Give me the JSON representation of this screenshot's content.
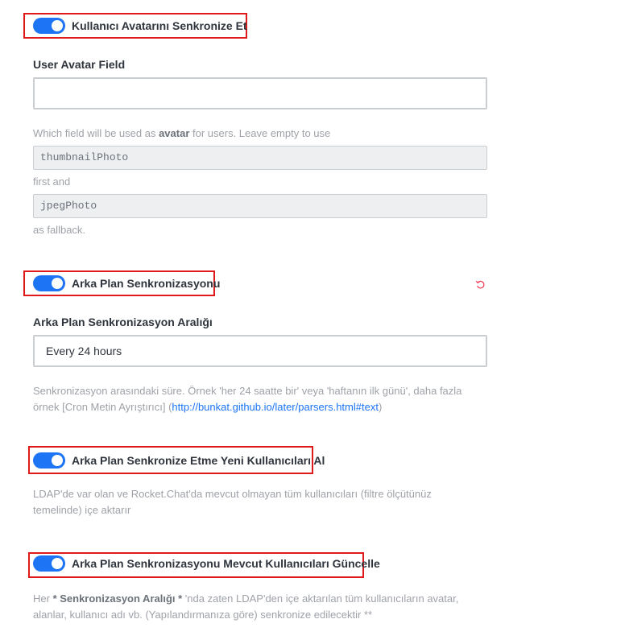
{
  "settings": {
    "sync_avatar": {
      "label": "Kullanıcı Avatarını Senkronize Et",
      "enabled": true
    },
    "avatar_field": {
      "label": "User Avatar Field",
      "value": "",
      "hint_prefix": "Which field will be used as ",
      "hint_bold": "avatar",
      "hint_suffix": " for users. Leave empty to use",
      "code_primary": "thumbnailPhoto",
      "middle_text": "first and",
      "code_fallback": "jpegPhoto",
      "end_text": "as fallback."
    },
    "background_sync": {
      "label": "Arka Plan Senkronizasyonu",
      "enabled": true,
      "reset_icon": "reset-icon"
    },
    "background_sync_interval": {
      "label": "Arka Plan Senkronizasyon Aralığı",
      "value": "Every 24 hours",
      "hint_line1": "Senkronizasyon arasındaki süre. Örnek 'her 24 saatte bir' veya 'haftanın ilk günü', daha fazla",
      "hint_line2_prefix": "örnek [Cron Metin Ayrıştırıcı] (",
      "hint_link": "http://bunkat.github.io/later/parsers.html#text",
      "hint_line2_suffix": ")"
    },
    "background_sync_import_new": {
      "label": "Arka Plan Senkronize Etme Yeni Kullanıcıları Al",
      "enabled": true,
      "hint_line1": "LDAP'de var olan ve Rocket.Chat'da mevcut olmayan tüm kullanıcıları (filtre ölçütünüz",
      "hint_line2": "temelinde) içe aktarır"
    },
    "background_sync_update_existing": {
      "label": "Arka Plan Senkronizasyonu Mevcut Kullanıcıları Güncelle",
      "enabled": true,
      "hint_prefix": "Her ",
      "hint_bold": "* Senkronizasyon Aralığı *",
      "hint_line1_suffix": " 'nda zaten LDAP'den içe aktarılan tüm kullanıcıların avatar,",
      "hint_line2": "alanlar, kullanıcı adı vb. (Yapılandırmanıza göre) senkronize edilecektir **"
    }
  },
  "colors": {
    "toggle_on": "#1d74f5",
    "highlight": "#e0191b",
    "reset_icon": "#f5455c",
    "link": "#1d74f5"
  }
}
